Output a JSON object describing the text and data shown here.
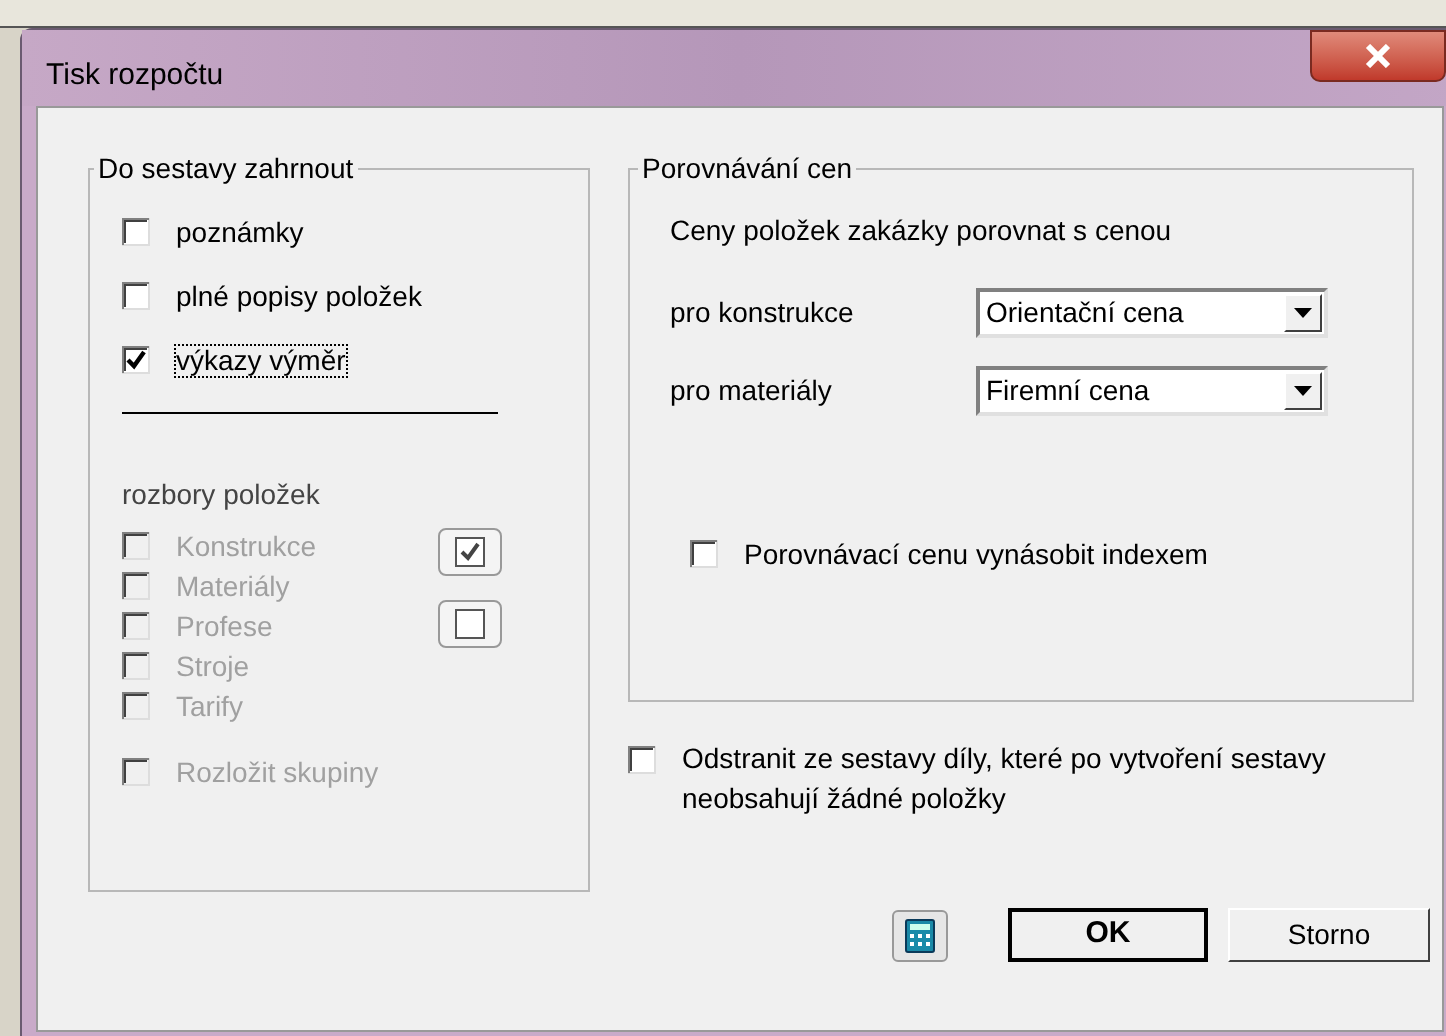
{
  "window": {
    "title": "Tisk rozpočtu"
  },
  "include_group": {
    "title": "Do sestavy zahrnout",
    "options": [
      {
        "label": "poznámky",
        "checked": false,
        "focused": false
      },
      {
        "label": "plné popisy položek",
        "checked": false,
        "focused": false
      },
      {
        "label": "výkazy výměr",
        "checked": true,
        "focused": true
      }
    ],
    "analysis_title": "rozbory položek",
    "analysis_items": [
      {
        "label": "Konstrukce",
        "checked": false,
        "disabled": true
      },
      {
        "label": "Materiály",
        "checked": false,
        "disabled": true
      },
      {
        "label": "Profese",
        "checked": false,
        "disabled": true
      },
      {
        "label": "Stroje",
        "checked": false,
        "disabled": true
      },
      {
        "label": "Tarify",
        "checked": false,
        "disabled": true
      }
    ],
    "split_groups": {
      "label": "Rozložit skupiny",
      "checked": false,
      "disabled": true
    }
  },
  "price_group": {
    "title": "Porovnávání cen",
    "description": "Ceny položek zakázky porovnat s cenou",
    "rows": [
      {
        "label": "pro konstrukce",
        "value": "Orientační cena"
      },
      {
        "label": "pro materiály",
        "value": "Firemní cena"
      }
    ],
    "multiply": {
      "label": "Porovnávací cenu vynásobit indexem",
      "checked": false
    }
  },
  "remove_empty": {
    "label": "Odstranit ze sestavy díly, které po vytvoření sestavy neobsahují žádné položky",
    "checked": false
  },
  "buttons": [
    {
      "label": "OK",
      "default": true
    },
    {
      "label": "Storno",
      "default": false
    }
  ]
}
